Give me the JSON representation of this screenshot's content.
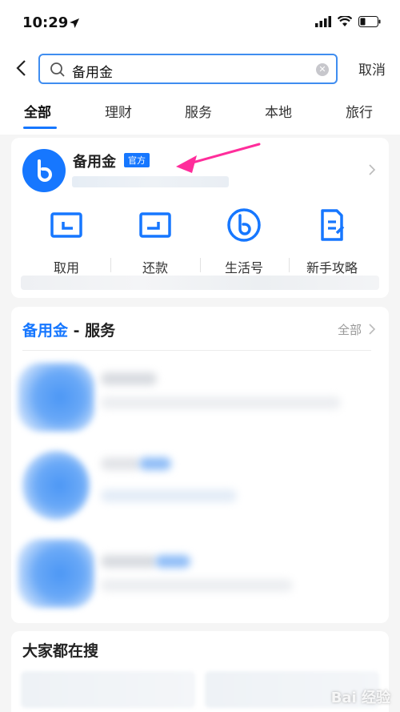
{
  "status": {
    "time": "10:29"
  },
  "search": {
    "query": "备用金",
    "cancel": "取消"
  },
  "tabs": [
    {
      "label": "全部",
      "active": true
    },
    {
      "label": "理财"
    },
    {
      "label": "服务"
    },
    {
      "label": "本地"
    },
    {
      "label": "旅行"
    }
  ],
  "official": {
    "name": "备用金",
    "badge": "官方",
    "shortcuts": [
      {
        "label": "取用",
        "icon": "withdraw-icon"
      },
      {
        "label": "还款",
        "icon": "repay-icon"
      },
      {
        "label": "生活号",
        "icon": "life-account-icon"
      },
      {
        "label": "新手攻略",
        "icon": "guide-icon"
      }
    ]
  },
  "services": {
    "title_highlight": "备用金",
    "title_rest": " - 服务",
    "all": "全部"
  },
  "hot_search": {
    "title": "大家都在搜"
  },
  "watermark": "Bai 经验",
  "colors": {
    "accent": "#1677ff",
    "annotation": "#ff2d9b"
  }
}
